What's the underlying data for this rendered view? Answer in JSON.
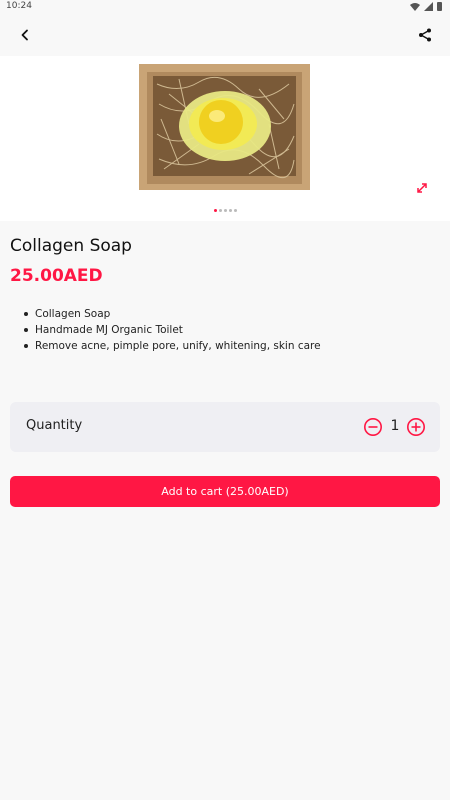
{
  "status_bar": {
    "time": "10:24",
    "icons": [
      "wifi-icon",
      "signal-icon",
      "battery-icon"
    ]
  },
  "top_bar": {
    "icons": [
      "back-arrow-icon",
      "share-icon"
    ]
  },
  "gallery": {
    "image_count": 5,
    "active_index": 0,
    "icons": [
      "expand-icon"
    ]
  },
  "product": {
    "title": "Collagen Soap",
    "price": "25.00AED",
    "features": [
      "Collagen Soap",
      "Handmade MJ Organic Toilet",
      "Remove acne, pimple pore, unify, whitening, skin care"
    ]
  },
  "quantity": {
    "label": "Quantity",
    "value": "1",
    "icons": [
      "minus-circle-icon",
      "plus-circle-icon"
    ]
  },
  "cart_button": {
    "label": "Add to cart (25.00AED)"
  },
  "colors": {
    "accent": "#ff1744",
    "background": "#f8f8f8",
    "card": "#efeff3"
  }
}
